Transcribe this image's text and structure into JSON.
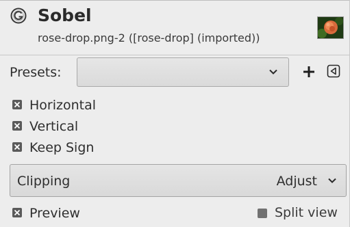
{
  "header": {
    "icon": "gimp-filter-icon",
    "title": "Sobel",
    "subtitle": "rose-drop.png-2 ([rose-drop] (imported))",
    "thumbnail": "rose-thumbnail"
  },
  "presets": {
    "label": "Presets:",
    "value": "",
    "add_icon": "plus-icon",
    "menu_icon": "menu-triangle-icon"
  },
  "options": [
    {
      "label": "Horizontal",
      "checked": true
    },
    {
      "label": "Vertical",
      "checked": true
    },
    {
      "label": "Keep Sign",
      "checked": true
    }
  ],
  "clipping": {
    "label": "Clipping",
    "value": "Adjust"
  },
  "footer": {
    "preview_label": "Preview",
    "preview_checked": true,
    "split_label": "Split view",
    "split_checked": false
  },
  "colors": {
    "background": "#ededed",
    "checkbox": "#5a5a5a",
    "text": "#2e2e2e"
  }
}
